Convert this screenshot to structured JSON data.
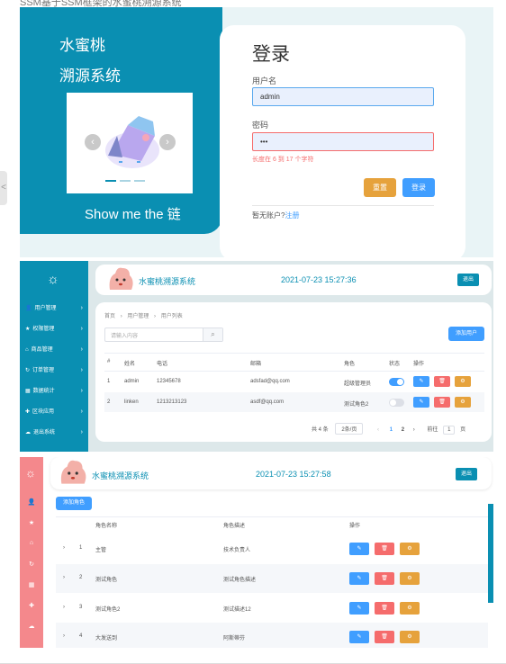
{
  "caption": "SSM基于SSM框架的水蜜桃溯源系统",
  "side_tab": "<",
  "login_page": {
    "brand_line1": "水蜜桃",
    "brand_line2": "溯源系统",
    "slogan": "Show me the 链",
    "carousel_prev": "‹",
    "carousel_next": "›",
    "title": "登录",
    "username_label": "用户名",
    "username_value": "admin",
    "password_label": "密码",
    "password_value": "•••",
    "password_error": "长度在 6 到 17 个字符",
    "reset_button": "重置",
    "login_button": "登录",
    "register_prompt": "暂无账户?",
    "register_link": "注册"
  },
  "user_page": {
    "sun_icon": "☼",
    "menu": [
      {
        "icon": "person-icon",
        "glyph": "👤",
        "label": "用户管理"
      },
      {
        "icon": "star-icon",
        "glyph": "★",
        "label": "权限管理"
      },
      {
        "icon": "shop-icon",
        "glyph": "⌂",
        "label": "商品管理"
      },
      {
        "icon": "order-icon",
        "glyph": "↻",
        "label": "订单管理"
      },
      {
        "icon": "chart-icon",
        "glyph": "▦",
        "label": "数据统计"
      },
      {
        "icon": "plus-icon",
        "glyph": "✚",
        "label": "区块应用"
      },
      {
        "icon": "cloud-icon",
        "glyph": "☁",
        "label": "退出系统"
      }
    ],
    "menu_arrow": "›",
    "site_title": "水蜜桃溯源系统",
    "datetime": "2021-07-23 15:27:36",
    "logout": "退出",
    "breadcrumb": [
      "首页",
      "用户管理",
      "用户列表"
    ],
    "breadcrumb_sep": "›",
    "search_placeholder": "请输入内容",
    "search_icon": "⌕",
    "add_user": "添加用户",
    "columns": [
      "#",
      "姓名",
      "电话",
      "邮箱",
      "角色",
      "状态",
      "操作"
    ],
    "rows": [
      {
        "index": "1",
        "name": "admin",
        "phone": "12345678",
        "email": "adsfad@qq.com",
        "role": "超级管理员",
        "enabled": true
      },
      {
        "index": "2",
        "name": "linken",
        "phone": "1213213123",
        "email": "asdf@qq.com",
        "role": "测试角色2",
        "enabled": false
      }
    ],
    "action_edit": "✎",
    "action_delete": "🗑",
    "action_setting": "⚙",
    "pagination": {
      "total": "共 4 条",
      "page_size": "2条/页",
      "prev": "‹",
      "pages": [
        "1",
        "2"
      ],
      "next": "›",
      "goto_label": "前往",
      "goto_value": "1",
      "page_unit": "页"
    },
    "colors": {
      "primary": "#0a8fb2",
      "blue": "#409eff",
      "danger": "#f56c6c",
      "warning": "#e6a23c"
    }
  },
  "role_page": {
    "sun_icon": "☼",
    "side_icons": [
      "👤",
      "★",
      "⌂",
      "↻",
      "▦",
      "✚",
      "☁"
    ],
    "site_title": "水蜜桃溯源系统",
    "datetime": "2021-07-23 15:27:58",
    "logout": "退出",
    "add_role": "添加角色",
    "columns": [
      "角色名称",
      "角色描述",
      "操作"
    ],
    "rows": [
      {
        "index": "1",
        "name": "主管",
        "desc": "技术负责人"
      },
      {
        "index": "2",
        "name": "测试角色",
        "desc": "测试角色描述"
      },
      {
        "index": "3",
        "name": "测试角色2",
        "desc": "测试描述12"
      },
      {
        "index": "4",
        "name": "大发送到",
        "desc": "阿斯蒂芬"
      }
    ],
    "expand_icon": "›"
  }
}
